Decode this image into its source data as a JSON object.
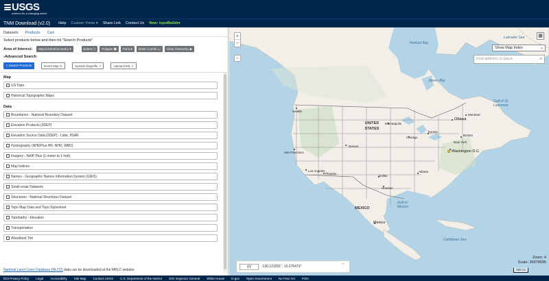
{
  "header": {
    "logo_text": "USGS",
    "logo_tagline": "science for a changing world"
  },
  "nav": {
    "title": "TNM Download (v2.0)",
    "help": "Help",
    "custom_views": "Custom Views",
    "share_link": "Share Link",
    "contact_us": "Contact Us",
    "new_topobuilder": "New: topoBuilder"
  },
  "tabs": [
    "Datasets",
    "Products",
    "Cart"
  ],
  "instructions": "Select products below and then hit \"Search Products\"",
  "area_of_interest": {
    "label": "Area of Interest:",
    "map_extent": "Map Extent/Geometry",
    "extent": "Extent",
    "polygon": "Polygon",
    "point": "Point",
    "enter_coords": "Enter Coords",
    "clear_geometry": "Clear Geometry"
  },
  "advanced_search": "Advanced Search",
  "actions": {
    "search_products": "Search Products",
    "reset_map": "Reset Map",
    "upload_shapefile": "Upload shapefile",
    "upload_kml": "Upload KML"
  },
  "sections": {
    "map": {
      "title": "Map",
      "items": [
        "US Topo",
        "Historical Topographic Maps"
      ]
    },
    "data": {
      "title": "Data",
      "items": [
        "Boundaries - National Boundary Dataset",
        "Elevation Products (3DEP)",
        "Elevation Source Data (3DEP) - Lidar, IfSAR",
        "Hydrography (NHDPlus HR, NHD, WBD)",
        "Imagery - NAIP Plus (1 meter to 1 foot)",
        "Map Indices",
        "Names - Geographic Names Information System (GNIS)",
        "Small-scale Datasets",
        "Structures - National Structures Dataset",
        "Topo Map Data and Topo Stylesheet",
        "Topobathy - Elevation",
        "Transportation",
        "Woodland Tint"
      ]
    }
  },
  "footnote": {
    "link": "National Land Cover Database (NLCD)",
    "text": " data can be downloaded at the MRLC website."
  },
  "map": {
    "layer_select": "Show Map Index",
    "search_placeholder": "Find address or place",
    "xy_label": "XY",
    "coords": "-130.123291°, 10.276473°",
    "zoom_text": "Zoom: 4",
    "scale_text": "Scale: 36978595",
    "scale_bar": "600 mi",
    "labels": {
      "labrador_sea": "Labrador Sea",
      "hudson_bay": "Hudson Bay",
      "james_bay": "James Bay",
      "gulf_st_lawrence": "Gulf of St. Lawrence",
      "united_states": "UNITED STATES",
      "mexico": "MEXICO",
      "gulf_mexico": "Gulf of Mexico",
      "caribbean_sea": "Caribbean Sea",
      "seattle": "Seattle",
      "san_francisco": "San Francisco",
      "los_angeles": "Los Angeles",
      "phoenix": "Phoenix",
      "denver": "Denver",
      "minneapolis": "Minneapolis",
      "chicago": "Chicago",
      "dallas": "Dallas",
      "houston": "Houston",
      "atlanta": "Atlanta",
      "new_york": "New York",
      "washington": "Washington D.C.",
      "toronto": "Toronto",
      "ottawa": "Ottawa",
      "montreal": "Montreal",
      "boston": "Boston",
      "mexico_city": "Mexico"
    }
  },
  "footer": [
    "DOI Privacy Policy",
    "Legal",
    "Accessibility",
    "Site Map",
    "Contact USGS",
    "U.S. Department of the Interior",
    "DOI Inspector General",
    "White House",
    "E-gov",
    "Open Government",
    "No Fear Act",
    "FOIA"
  ]
}
